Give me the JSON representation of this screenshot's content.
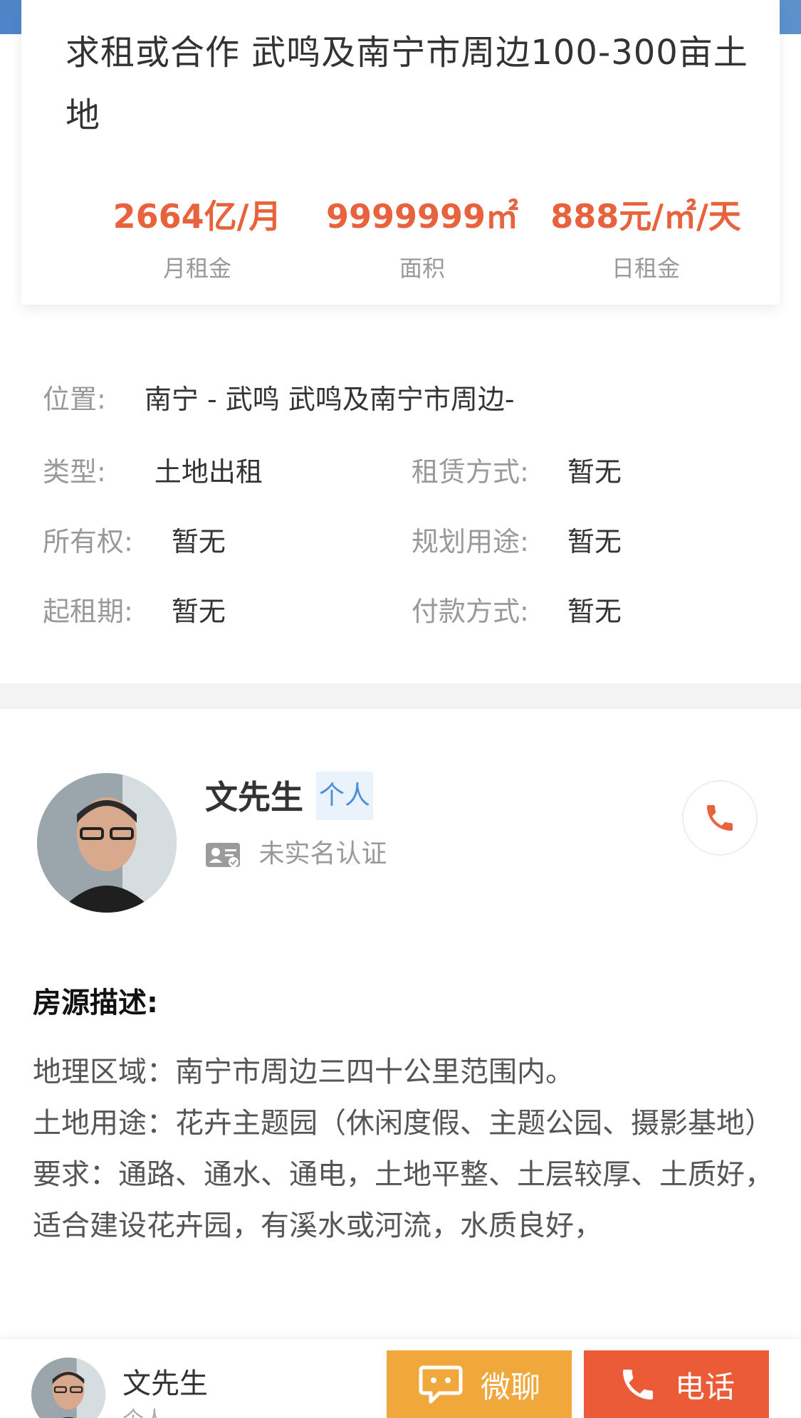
{
  "listing": {
    "title": "求租或合作 武鸣及南宁市周边100-300亩土地",
    "stats": [
      {
        "value": "2664亿/月",
        "label": "月租金"
      },
      {
        "value": "9999999㎡",
        "label": "面积"
      },
      {
        "value": "888元/㎡/天",
        "label": "日租金"
      }
    ]
  },
  "info": {
    "location_label": "位置:",
    "location_value": "南宁 - 武鸣 武鸣及南宁市周边-",
    "type_label": "类型:",
    "type_value": "土地出租",
    "lease_label": "租赁方式:",
    "lease_value": "暂无",
    "ownership_label": "所有权:",
    "ownership_value": "暂无",
    "usage_label": "规划用途:",
    "usage_value": "暂无",
    "start_label": "起租期:",
    "start_value": "暂无",
    "payment_label": "付款方式:",
    "payment_value": "暂无"
  },
  "owner": {
    "name": "文先生",
    "tag": "个人",
    "verify": "未实名认证"
  },
  "description": {
    "title": "房源描述:",
    "lines": [
      "地理区域：南宁市周边三四十公里范围内。",
      "土地用途：花卉主题园（休闲度假、主题公园、摄影基地）",
      "要求：通路、通水、通电，土地平整、土层较厚、土质好，适合建设花卉园，有溪水或河流，水质良好，"
    ]
  },
  "bottom_bar": {
    "name": "文先生",
    "tag": "个人",
    "chat_label": "微聊",
    "phone_label": "电话"
  },
  "colors": {
    "accent": "#e8623d",
    "chat": "#f0a83c",
    "phone": "#ec5b37",
    "tag_blue": "#4a90d9"
  },
  "icons": [
    "phone-icon",
    "chat-bubble-icon",
    "id-card-icon"
  ]
}
